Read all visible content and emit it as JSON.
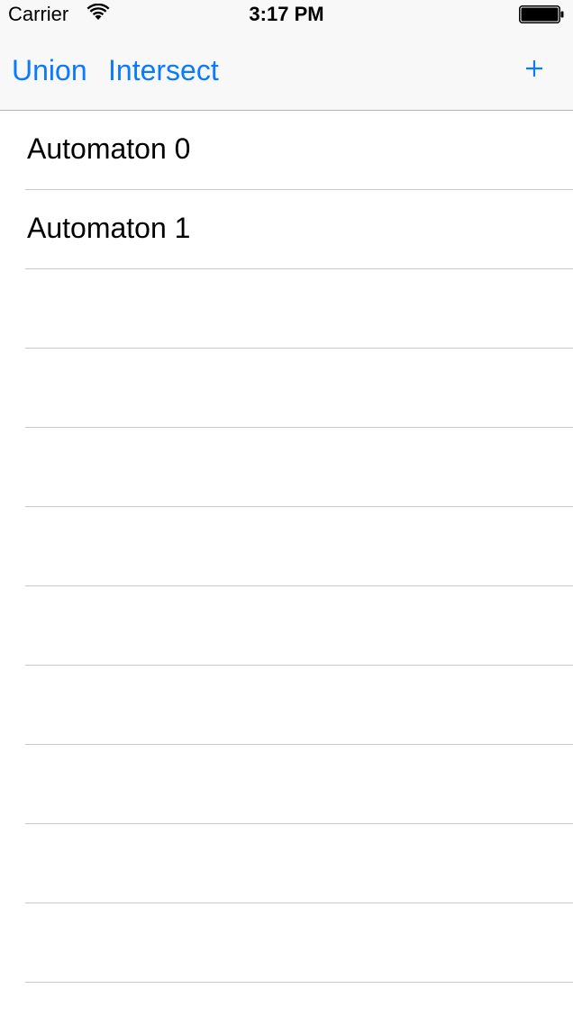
{
  "status_bar": {
    "carrier": "Carrier",
    "time": "3:17 PM",
    "wifi_icon": "wifi-icon",
    "battery_icon": "battery-icon"
  },
  "nav_bar": {
    "union_label": "Union",
    "intersect_label": "Intersect",
    "add_label": "+",
    "tint_color": "#0a7aff"
  },
  "table": {
    "rows": [
      {
        "label": "Automaton 0"
      },
      {
        "label": "Automaton 1"
      },
      {
        "label": ""
      },
      {
        "label": ""
      },
      {
        "label": ""
      },
      {
        "label": ""
      },
      {
        "label": ""
      },
      {
        "label": ""
      },
      {
        "label": ""
      },
      {
        "label": ""
      },
      {
        "label": ""
      }
    ]
  }
}
